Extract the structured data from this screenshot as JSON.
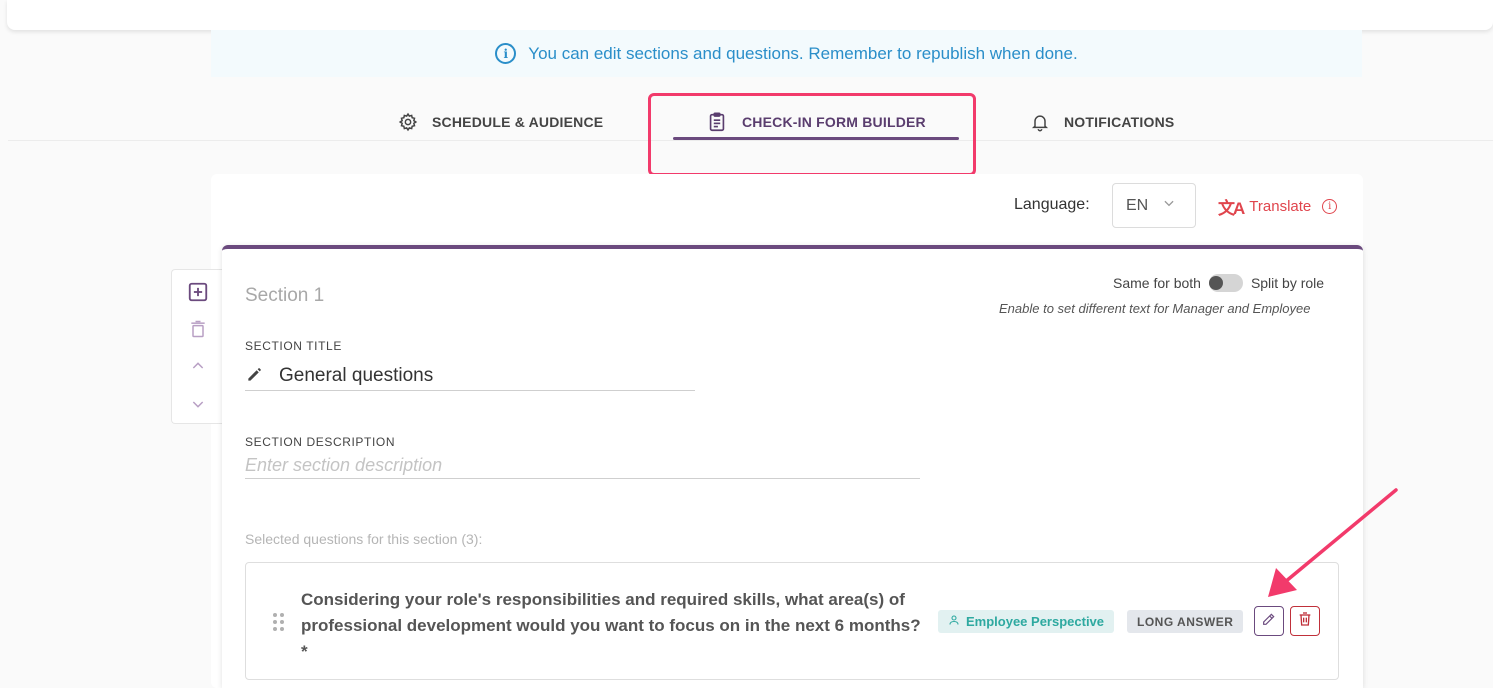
{
  "banner": {
    "text": "You can edit sections and questions. Remember to republish when done.",
    "icon": "info-icon"
  },
  "tabs": [
    {
      "label": "SCHEDULE & AUDIENCE",
      "icon": "gear-icon",
      "active": false
    },
    {
      "label": "CHECK-IN FORM BUILDER",
      "icon": "clipboard-icon",
      "active": true
    },
    {
      "label": "NOTIFICATIONS",
      "icon": "bell-icon",
      "active": false
    }
  ],
  "language": {
    "label": "Language:",
    "value": "EN",
    "translate_label": "Translate"
  },
  "section": {
    "name": "Section 1",
    "split": {
      "left_label": "Same for both",
      "right_label": "Split by role",
      "hint": "Enable to set different text for Manager and Employee",
      "enabled": false
    },
    "title_label": "SECTION TITLE",
    "title_value": "General questions",
    "description_label": "SECTION DESCRIPTION",
    "description_placeholder": "Enter section description",
    "selected_label": "Selected questions for this section (3):"
  },
  "questions": [
    {
      "text": "Considering your role's responsibilities and required skills, what area(s) of professional development would you want to focus on in the next 6 months? *",
      "perspective": "Employee Perspective",
      "type": "LONG ANSWER"
    }
  ],
  "colors": {
    "accent": "#6b4a7e",
    "highlight": "#f23a6b",
    "info": "#2a8ec9",
    "danger": "#c0303a",
    "teal": "#2ea9a0"
  }
}
